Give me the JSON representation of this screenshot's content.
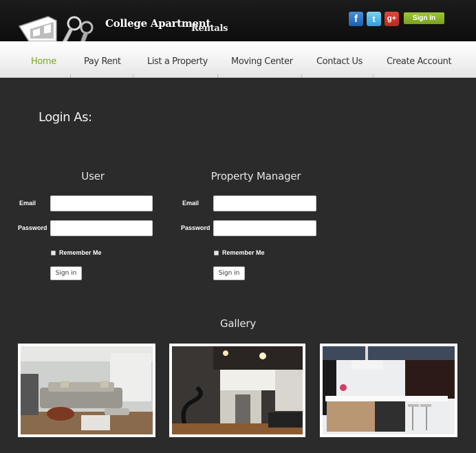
{
  "header": {
    "logo_title": "College Apartment",
    "logo_subtitle": "Rentals",
    "social": {
      "facebook_glyph": "f",
      "twitter_glyph": "t",
      "google_glyph": "g+"
    },
    "signin_label": "Sign In"
  },
  "nav": {
    "items": [
      {
        "label": "Home",
        "active": true
      },
      {
        "label": "Pay Rent"
      },
      {
        "label": "List a Property"
      },
      {
        "label": "Moving Center"
      },
      {
        "label": "Contact Us"
      },
      {
        "label": "Create Account"
      }
    ]
  },
  "login": {
    "title": "Login As:",
    "user": {
      "heading": "User",
      "email_label": "Email",
      "password_label": "Password",
      "remember_label": "Remember Me",
      "submit_label": "Sign in"
    },
    "manager": {
      "heading": "Property Manager",
      "email_label": "Email",
      "password_label": "Password",
      "remember_label": "Remember Me",
      "submit_label": "Sign in"
    }
  },
  "gallery": {
    "title": "Gallery",
    "images": [
      "living-room-photo",
      "loft-staircase-photo",
      "kitchen-photo"
    ]
  },
  "colors": {
    "accent": "#7ea51e",
    "background": "#2b2b2b",
    "header": "#111111"
  }
}
